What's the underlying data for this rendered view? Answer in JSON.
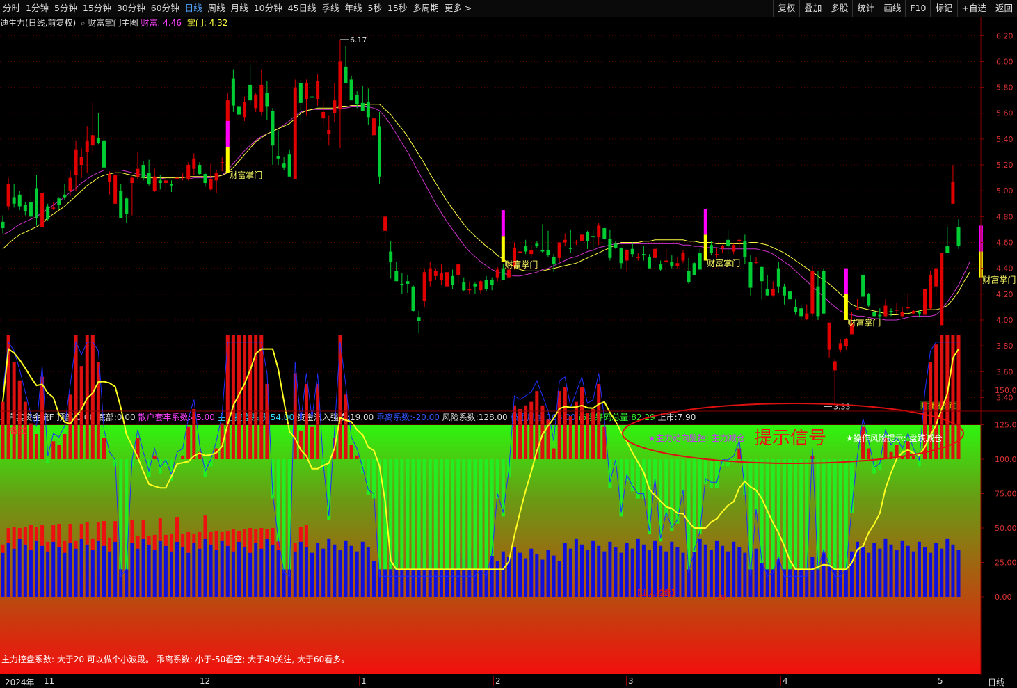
{
  "toolbar": {
    "tabs": [
      "分时",
      "1分钟",
      "5分钟",
      "15分钟",
      "30分钟",
      "60分钟",
      "日线",
      "周线",
      "月线",
      "10分钟",
      "45日线",
      "季线",
      "年线",
      "5秒",
      "15秒",
      "多周期",
      "更多 >"
    ],
    "active_tab": "日线",
    "right_buttons": [
      "复权",
      "叠加",
      "多股",
      "统计",
      "画线",
      "F10",
      "标记",
      "+自选",
      "返回"
    ]
  },
  "main_header": {
    "stock": "迪生力(日线,前复权)",
    "indicator": "财富掌门主图",
    "caifu_label": "财富:",
    "caifu_value": "4.46",
    "zhangmen_label": "掌门:",
    "zhangmen_value": "4.32"
  },
  "price_axis": {
    "ticks": [
      "6.20",
      "6.00",
      "5.80",
      "5.60",
      "5.40",
      "5.20",
      "5.00",
      "4.80",
      "4.60",
      "4.40",
      "4.20",
      "4.00",
      "3.80",
      "3.60",
      "3.40"
    ]
  },
  "annotations": {
    "high": "6.17",
    "low": "3.33",
    "signal_label": "财富掌门",
    "corner_label": "财播涨榜跌"
  },
  "ind_header": {
    "name": "真实资金流F",
    "items": [
      {
        "k": "顶部:",
        "v": "0.00",
        "c": "#dddddd"
      },
      {
        "k": "底部:",
        "v": "0.00",
        "c": "#dddddd"
      },
      {
        "k": "散户套牢系数:",
        "v": "45.00",
        "c": "#ff44ff"
      },
      {
        "k": "主力控盘系数:",
        "v": "54.00",
        "c": "#33ddff"
      },
      {
        "k": "资金流入强度:",
        "v": "19.00",
        "c": "#dddddd"
      },
      {
        "k": "乖离系数:",
        "v": "-20.00",
        "c": "#3355ff"
      },
      {
        "k": "风险系数:",
        "v": "128.00",
        "c": "#dddddd"
      },
      {
        "k": "极限风险:",
        "v": "108.00",
        "c": "#3355ff"
      },
      {
        "k": "市场筹码总量:",
        "v": "82.29",
        "c": "#33ff33"
      },
      {
        "k": "上市:",
        "v": "7.90",
        "c": "#dddddd"
      }
    ]
  },
  "ind_axis": {
    "ticks": [
      "150.0",
      "125.0",
      "100.0",
      "75.00",
      "50.00",
      "25.00",
      "0.00"
    ]
  },
  "ind_texts": {
    "beizhu": "备注",
    "monitor": "★主力动向监控: 主力减仓",
    "tishi": "提示信号",
    "risk": "★操作风险提示: 盘跌减仓",
    "bottom_tag": "【主力控盘】",
    "tag_num": "10",
    "note": "主力控盘系数: 大于20 可以做个小波段。     乖离系数: 小于-50看空; 大于40关注, 大于60看多。"
  },
  "time_axis": {
    "labels": [
      "2024年",
      "11",
      "12",
      "1",
      "2",
      "3",
      "4",
      "5"
    ],
    "period": "日线"
  },
  "colors": {
    "up": "#e00000",
    "down": "#00cc33",
    "ma1": "#ffff44",
    "ma2": "#cc33cc",
    "axis": "#8b0000",
    "signal_magenta": "#ff00ff",
    "signal_yellow": "#ffff00"
  },
  "chart_data": {
    "type": "candlestick",
    "ylim": [
      3.3,
      6.25
    ],
    "ohlc": [
      [
        4.76,
        4.81,
        4.67,
        4.71
      ],
      [
        4.88,
        5.1,
        4.85,
        5.05
      ],
      [
        4.95,
        5.05,
        4.87,
        4.9
      ],
      [
        4.97,
        5.0,
        4.85,
        4.88
      ],
      [
        4.89,
        4.91,
        4.81,
        4.84
      ],
      [
        4.91,
        5.02,
        4.78,
        4.8
      ],
      [
        5.02,
        5.12,
        4.73,
        4.79
      ],
      [
        4.72,
        5.1,
        4.69,
        4.98
      ],
      [
        4.88,
        4.9,
        4.77,
        4.78
      ],
      [
        4.87,
        4.91,
        4.85,
        4.87
      ],
      [
        4.94,
        4.95,
        4.86,
        4.89
      ],
      [
        4.97,
        5.05,
        4.93,
        4.95
      ],
      [
        5.0,
        5.16,
        4.96,
        5.1
      ],
      [
        5.12,
        5.39,
        5.0,
        5.32
      ],
      [
        5.2,
        5.33,
        5.1,
        5.26
      ],
      [
        5.3,
        5.5,
        5.14,
        5.39
      ],
      [
        5.35,
        5.69,
        5.28,
        5.43
      ],
      [
        5.41,
        5.6,
        5.36,
        5.37
      ],
      [
        5.39,
        5.42,
        5.16,
        5.18
      ],
      [
        5.07,
        5.15,
        4.97,
        5.13
      ],
      [
        4.9,
        5.17,
        4.88,
        5.12
      ],
      [
        5.0,
        5.05,
        4.79,
        4.79
      ],
      [
        4.94,
        4.95,
        4.75,
        4.82
      ],
      [
        5.06,
        5.11,
        4.81,
        5.1
      ],
      [
        5.11,
        5.3,
        5.09,
        5.17
      ],
      [
        5.2,
        5.23,
        5.08,
        5.1
      ],
      [
        5.14,
        5.24,
        5.04,
        5.05
      ],
      [
        5.0,
        5.17,
        4.99,
        5.11
      ],
      [
        5.08,
        5.12,
        5.01,
        5.06
      ],
      [
        5.06,
        5.11,
        5.0,
        5.08
      ],
      [
        5.05,
        5.08,
        4.99,
        5.04
      ],
      [
        5.09,
        5.14,
        5.03,
        5.1
      ],
      [
        5.11,
        5.14,
        5.08,
        5.11
      ],
      [
        5.09,
        5.22,
        5.08,
        5.2
      ],
      [
        5.17,
        5.29,
        5.12,
        5.25
      ],
      [
        5.2,
        5.22,
        5.12,
        5.13
      ],
      [
        5.13,
        5.14,
        5.03,
        5.06
      ],
      [
        5.01,
        5.21,
        5.0,
        5.09
      ],
      [
        5.08,
        5.16,
        4.98,
        5.14
      ],
      [
        5.22,
        5.26,
        5.15,
        5.22
      ],
      [
        5.37,
        5.76,
        5.35,
        5.7
      ],
      [
        5.87,
        5.94,
        5.61,
        5.66
      ],
      [
        5.65,
        5.7,
        5.55,
        5.59
      ],
      [
        5.57,
        5.73,
        5.54,
        5.69
      ],
      [
        5.82,
        5.97,
        5.66,
        5.7
      ],
      [
        5.64,
        5.76,
        5.61,
        5.74
      ],
      [
        5.61,
        5.94,
        5.58,
        5.82
      ],
      [
        5.76,
        5.85,
        5.55,
        5.65
      ],
      [
        5.62,
        5.64,
        5.2,
        5.35
      ],
      [
        5.27,
        5.47,
        5.2,
        5.25
      ],
      [
        5.21,
        5.26,
        5.16,
        5.18
      ],
      [
        5.28,
        5.32,
        5.11,
        5.11
      ],
      [
        5.09,
        5.86,
        5.09,
        5.8
      ],
      [
        5.83,
        5.86,
        5.53,
        5.68
      ],
      [
        5.71,
        5.86,
        5.58,
        5.83
      ],
      [
        5.73,
        5.94,
        5.64,
        5.72
      ],
      [
        5.71,
        5.9,
        5.66,
        5.85
      ],
      [
        5.56,
        5.7,
        5.51,
        5.61
      ],
      [
        5.44,
        5.58,
        5.35,
        5.47
      ],
      [
        5.6,
        5.83,
        5.53,
        5.7
      ],
      [
        5.63,
        6.17,
        5.33,
        6.0
      ],
      [
        5.96,
        6.12,
        5.84,
        5.83
      ],
      [
        5.86,
        5.89,
        5.7,
        5.7
      ],
      [
        5.74,
        5.77,
        5.64,
        5.67
      ],
      [
        5.68,
        5.81,
        5.62,
        5.62
      ],
      [
        5.69,
        5.79,
        5.51,
        5.57
      ],
      [
        5.43,
        5.6,
        5.4,
        5.56
      ],
      [
        5.5,
        5.61,
        5.05,
        5.11
      ],
      [
        4.69,
        4.81,
        4.58,
        4.8
      ],
      [
        4.53,
        4.61,
        4.32,
        4.45
      ],
      [
        4.38,
        4.45,
        4.3,
        4.3
      ],
      [
        4.28,
        4.36,
        4.2,
        4.27
      ],
      [
        4.3,
        4.35,
        4.21,
        4.28
      ],
      [
        4.26,
        4.27,
        4.06,
        4.07
      ],
      [
        4.02,
        4.07,
        3.9,
        3.99
      ],
      [
        4.15,
        4.4,
        4.1,
        4.37
      ],
      [
        4.3,
        4.45,
        4.26,
        4.4
      ],
      [
        4.34,
        4.4,
        4.31,
        4.38
      ],
      [
        4.31,
        4.43,
        4.27,
        4.36
      ],
      [
        4.26,
        4.38,
        4.24,
        4.37
      ],
      [
        4.34,
        4.39,
        4.24,
        4.27
      ],
      [
        4.35,
        4.44,
        4.28,
        4.43
      ],
      [
        4.29,
        4.33,
        4.22,
        4.23
      ],
      [
        4.23,
        4.3,
        4.2,
        4.24
      ],
      [
        4.28,
        4.29,
        4.2,
        4.26
      ],
      [
        4.23,
        4.31,
        4.2,
        4.3
      ],
      [
        4.31,
        4.34,
        4.22,
        4.24
      ],
      [
        4.31,
        4.33,
        4.23,
        4.27
      ],
      [
        4.33,
        4.41,
        4.3,
        4.39
      ],
      [
        4.4,
        4.43,
        4.31,
        4.31
      ],
      [
        4.33,
        4.45,
        4.29,
        4.39
      ],
      [
        4.41,
        4.6,
        4.39,
        4.56
      ],
      [
        4.53,
        4.6,
        4.52,
        4.53
      ],
      [
        4.57,
        4.62,
        4.51,
        4.53
      ],
      [
        4.51,
        4.58,
        4.48,
        4.54
      ],
      [
        4.59,
        4.61,
        4.56,
        4.57
      ],
      [
        4.54,
        4.74,
        4.52,
        4.53
      ],
      [
        4.54,
        4.69,
        4.49,
        4.5
      ],
      [
        4.49,
        4.51,
        4.37,
        4.43
      ],
      [
        4.48,
        4.6,
        4.45,
        4.6
      ],
      [
        4.6,
        4.67,
        4.57,
        4.62
      ],
      [
        4.56,
        4.7,
        4.52,
        4.55
      ],
      [
        4.6,
        4.62,
        4.58,
        4.6
      ],
      [
        4.61,
        4.73,
        4.48,
        4.66
      ],
      [
        4.68,
        4.69,
        4.55,
        4.61
      ],
      [
        4.65,
        4.7,
        4.52,
        4.64
      ],
      [
        4.64,
        4.75,
        4.58,
        4.73
      ],
      [
        4.71,
        4.72,
        4.62,
        4.63
      ],
      [
        4.63,
        4.7,
        4.46,
        4.48
      ],
      [
        4.59,
        4.61,
        4.55,
        4.56
      ],
      [
        4.56,
        4.56,
        4.4,
        4.44
      ],
      [
        4.46,
        4.55,
        4.37,
        4.54
      ],
      [
        4.55,
        4.6,
        4.49,
        4.51
      ],
      [
        4.48,
        4.52,
        4.46,
        4.49
      ],
      [
        4.51,
        4.57,
        4.46,
        4.5
      ],
      [
        4.49,
        4.51,
        4.4,
        4.4
      ],
      [
        4.48,
        4.58,
        4.44,
        4.55
      ],
      [
        4.43,
        4.46,
        4.38,
        4.39
      ],
      [
        4.45,
        4.55,
        4.44,
        4.46
      ],
      [
        4.45,
        4.5,
        4.4,
        4.42
      ],
      [
        4.42,
        4.49,
        4.4,
        4.44
      ],
      [
        4.46,
        4.54,
        4.44,
        4.52
      ],
      [
        4.38,
        4.48,
        4.28,
        4.29
      ],
      [
        4.44,
        4.45,
        4.35,
        4.35
      ],
      [
        4.52,
        4.55,
        4.39,
        4.39
      ],
      [
        4.52,
        4.56,
        4.51,
        4.53
      ],
      [
        4.58,
        4.61,
        4.5,
        4.52
      ],
      [
        4.51,
        4.56,
        4.48,
        4.51
      ],
      [
        4.56,
        4.58,
        4.52,
        4.57
      ],
      [
        4.62,
        4.7,
        4.51,
        4.57
      ],
      [
        4.53,
        4.59,
        4.51,
        4.58
      ],
      [
        4.61,
        4.63,
        4.56,
        4.62
      ],
      [
        4.61,
        4.66,
        4.43,
        4.49
      ],
      [
        4.45,
        4.5,
        4.19,
        4.25
      ],
      [
        4.45,
        4.49,
        4.43,
        4.45
      ],
      [
        4.41,
        4.42,
        4.16,
        4.3
      ],
      [
        4.24,
        4.35,
        4.19,
        4.19
      ],
      [
        4.19,
        4.3,
        4.18,
        4.24
      ],
      [
        4.4,
        4.45,
        4.21,
        4.26
      ],
      [
        4.26,
        4.28,
        4.12,
        4.19
      ],
      [
        4.22,
        4.24,
        4.14,
        4.16
      ],
      [
        4.1,
        4.16,
        4.04,
        4.06
      ],
      [
        4.09,
        4.12,
        4.0,
        4.03
      ],
      [
        4.01,
        4.12,
        4.0,
        4.05
      ],
      [
        4.05,
        4.42,
        4.03,
        4.38
      ],
      [
        4.26,
        4.38,
        4.0,
        4.03
      ],
      [
        4.38,
        4.4,
        4.05,
        4.05
      ],
      [
        3.77,
        3.98,
        3.71,
        3.98
      ],
      [
        3.61,
        3.7,
        3.33,
        3.68
      ],
      [
        3.77,
        3.85,
        3.75,
        3.82
      ],
      [
        3.8,
        3.86,
        3.77,
        3.85
      ],
      [
        3.89,
        4.06,
        3.89,
        3.97
      ],
      [
        4.09,
        4.16,
        4.09,
        4.09
      ],
      [
        4.35,
        4.39,
        4.13,
        4.18
      ],
      [
        4.2,
        4.21,
        4.1,
        4.11
      ],
      [
        4.06,
        4.07,
        4.03,
        4.03
      ],
      [
        4.04,
        4.09,
        4.01,
        4.03
      ],
      [
        4.03,
        4.16,
        4.02,
        4.11
      ],
      [
        4.07,
        4.09,
        4.03,
        4.06
      ],
      [
        4.08,
        4.13,
        4.04,
        4.08
      ],
      [
        4.03,
        4.1,
        4.02,
        4.06
      ],
      [
        4.09,
        4.2,
        4.08,
        4.1
      ],
      [
        4.05,
        4.08,
        4.05,
        4.07
      ],
      [
        4.06,
        4.08,
        4.02,
        4.05
      ],
      [
        4.04,
        4.24,
        4.04,
        4.24
      ],
      [
        4.09,
        4.38,
        4.08,
        4.35
      ],
      [
        4.26,
        4.42,
        4.19,
        4.4
      ],
      [
        3.96,
        4.45,
        3.96,
        4.52
      ],
      [
        4.57,
        4.72,
        4.57,
        4.52
      ],
      [
        4.9,
        5.2,
        4.9,
        5.07
      ],
      [
        4.72,
        4.78,
        4.55,
        4.57
      ]
    ],
    "ma1": [
      4.55,
      4.59,
      4.63,
      4.66,
      4.68,
      4.7,
      4.72,
      4.75,
      4.79,
      4.82,
      4.85,
      4.88,
      4.92,
      4.96,
      5.0,
      5.04,
      5.07,
      5.1,
      5.12,
      5.13,
      5.14,
      5.14,
      5.13,
      5.12,
      5.11,
      5.1,
      5.1,
      5.1,
      5.1,
      5.1,
      5.1,
      5.1,
      5.1,
      5.11,
      5.11,
      5.11,
      5.11,
      5.11,
      5.11,
      5.12,
      5.14,
      5.18,
      5.23,
      5.28,
      5.33,
      5.38,
      5.41,
      5.44,
      5.46,
      5.48,
      5.5,
      5.52,
      5.56,
      5.6,
      5.62,
      5.63,
      5.64,
      5.64,
      5.64,
      5.64,
      5.65,
      5.65,
      5.66,
      5.66,
      5.66,
      5.67,
      5.67,
      5.67,
      5.63,
      5.59,
      5.53,
      5.48,
      5.42,
      5.35,
      5.28,
      5.21,
      5.13,
      5.06,
      4.99,
      4.92,
      4.86,
      4.8,
      4.74,
      4.69,
      4.65,
      4.61,
      4.57,
      4.54,
      4.5,
      4.47,
      4.44,
      4.41,
      4.39,
      4.38,
      4.38,
      4.38,
      4.38,
      4.39,
      4.4,
      4.41,
      4.42,
      4.43,
      4.44,
      4.46,
      4.48,
      4.5,
      4.52,
      4.54,
      4.56,
      4.58,
      4.6,
      4.6,
      4.6,
      4.6,
      4.61,
      4.61,
      4.62,
      4.62,
      4.62,
      4.62,
      4.62,
      4.62,
      4.61,
      4.61,
      4.6,
      4.6,
      4.6,
      4.59,
      4.59,
      4.59,
      4.59,
      4.59,
      4.59,
      4.6,
      4.6,
      4.59,
      4.58,
      4.56,
      4.54,
      4.52,
      4.49,
      4.46,
      4.43,
      4.4,
      4.37,
      4.34,
      4.31,
      4.28,
      4.24,
      4.2,
      4.16,
      4.12,
      4.1,
      4.09,
      4.08,
      4.07,
      4.06,
      4.05,
      4.04,
      4.04,
      4.05,
      4.05,
      4.06,
      4.07,
      4.08,
      4.08,
      4.08,
      4.09,
      4.11,
      4.16,
      4.22,
      4.3,
      4.37
    ],
    "ma2": [
      4.66,
      4.68,
      4.71,
      4.74,
      4.76,
      4.78,
      4.8,
      4.83,
      4.86,
      4.89,
      4.92,
      4.95,
      4.99,
      5.02,
      5.06,
      5.09,
      5.12,
      5.14,
      5.16,
      5.16,
      5.16,
      5.16,
      5.15,
      5.14,
      5.13,
      5.12,
      5.11,
      5.1,
      5.1,
      5.09,
      5.09,
      5.09,
      5.09,
      5.09,
      5.1,
      5.1,
      5.1,
      5.1,
      5.11,
      5.12,
      5.16,
      5.21,
      5.26,
      5.31,
      5.35,
      5.39,
      5.42,
      5.44,
      5.46,
      5.48,
      5.51,
      5.54,
      5.58,
      5.61,
      5.62,
      5.63,
      5.63,
      5.63,
      5.63,
      5.63,
      5.64,
      5.64,
      5.65,
      5.65,
      5.65,
      5.65,
      5.64,
      5.62,
      5.57,
      5.51,
      5.44,
      5.37,
      5.3,
      5.22,
      5.14,
      5.06,
      4.98,
      4.9,
      4.83,
      4.76,
      4.7,
      4.64,
      4.58,
      4.53,
      4.49,
      4.45,
      4.42,
      4.39,
      4.37,
      4.36,
      4.35,
      4.34,
      4.34,
      4.35,
      4.36,
      4.37,
      4.39,
      4.4,
      4.42,
      4.44,
      4.46,
      4.48,
      4.49,
      4.51,
      4.53,
      4.54,
      4.56,
      4.57,
      4.58,
      4.59,
      4.59,
      4.59,
      4.59,
      4.59,
      4.59,
      4.59,
      4.59,
      4.59,
      4.59,
      4.59,
      4.59,
      4.58,
      4.58,
      4.57,
      4.57,
      4.56,
      4.56,
      4.56,
      4.55,
      4.55,
      4.55,
      4.55,
      4.55,
      4.55,
      4.55,
      4.54,
      4.53,
      4.51,
      4.48,
      4.45,
      4.42,
      4.38,
      4.34,
      4.3,
      4.26,
      4.22,
      4.18,
      4.14,
      4.1,
      4.07,
      4.05,
      4.04,
      4.03,
      4.03,
      4.02,
      4.01,
      4.01,
      4.0,
      4.0,
      4.0,
      4.01,
      4.02,
      4.03,
      4.03,
      4.03,
      4.03,
      4.04,
      4.08,
      4.14,
      4.2,
      4.27,
      4.36,
      4.45
    ]
  }
}
